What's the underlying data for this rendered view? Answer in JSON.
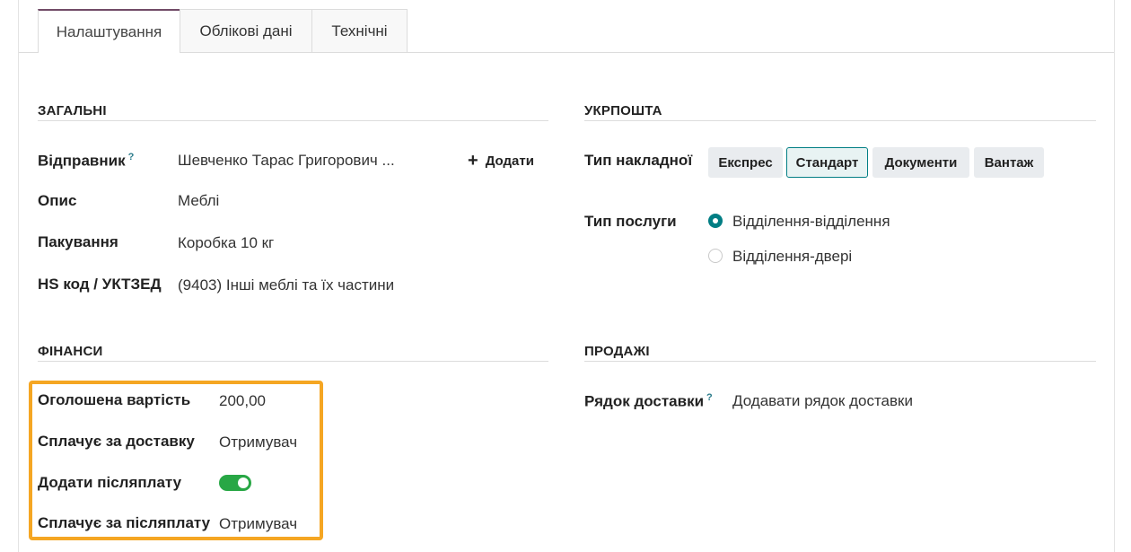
{
  "tabs": [
    "Налаштування",
    "Облікові дані",
    "Технічні"
  ],
  "general": {
    "title": "ЗАГАЛЬНІ",
    "sender_label": "Відправник",
    "sender_help": "?",
    "sender_value": "Шевченко Тарас Григорович ...",
    "add_label": "Додати",
    "description_label": "Опис",
    "description_value": "Меблі",
    "packaging_label": "Пакування",
    "packaging_value": "Коробка 10 кг",
    "hs_label": "HS код / УКТЗЕД",
    "hs_value": "(9403) Інші меблі та їх частини"
  },
  "ukrposhta": {
    "title": "УКРПОШТА",
    "waybill_label": "Тип накладної",
    "waybill_options": [
      "Експрес",
      "Стандарт",
      "Документи",
      "Вантаж"
    ],
    "waybill_selected": "Стандарт",
    "service_label": "Тип послуги",
    "service_options": [
      "Відділення-відділення",
      "Відділення-двері"
    ],
    "service_selected": "Відділення-відділення"
  },
  "finance": {
    "title": "ФІНАНСИ",
    "declared_label": "Оголошена вартість",
    "declared_value": "200,00",
    "delivery_payer_label": "Сплачує за доставку",
    "delivery_payer_value": "Отримувач",
    "cod_label": "Додати післяплату",
    "cod_enabled": true,
    "cod_payer_label": "Сплачує за післяплату",
    "cod_payer_value": "Отримувач",
    "highlight_color": "#f5a623"
  },
  "sales": {
    "title": "ПРОДАЖІ",
    "delivery_line_label": "Рядок доставки",
    "delivery_line_help": "?",
    "delivery_line_value": "Додавати рядок доставки"
  },
  "colors": {
    "accent": "#017e84",
    "tab_accent": "#714b67",
    "toggle_on": "#28a745"
  }
}
